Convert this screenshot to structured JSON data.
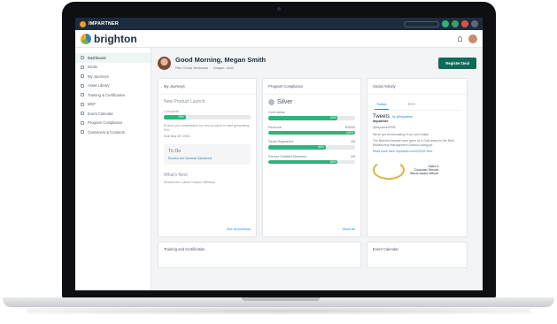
{
  "topbar": {
    "brand": "IMPARTNER"
  },
  "header": {
    "logo_text": "brighton"
  },
  "sidebar": {
    "items": [
      {
        "label": "Dashboard"
      },
      {
        "label": "Deals"
      },
      {
        "label": "My Journeys"
      },
      {
        "label": "Asset Library"
      },
      {
        "label": "Training & Certification"
      },
      {
        "label": "MDF"
      },
      {
        "label": "Event Calendar"
      },
      {
        "label": "Program Compliance"
      },
      {
        "label": "Customers & Contacts"
      }
    ]
  },
  "greeting": {
    "title": "Good Morning, Megan Smith",
    "company": "Red Cedar Networks",
    "location": "Draper, Utah",
    "register_button": "Register Deal"
  },
  "journeys": {
    "heading": "My Journeys",
    "journey_title": "New Product Launch",
    "status_label": "Complete",
    "progress_label": "25%",
    "progress": 0.25,
    "description": "Ensure you understand our new product to start generating ROI",
    "due": "Due Nov 29, 2021",
    "todo_title": "To Do",
    "todo_item": "Review the Newest Datasheet",
    "next_title": "What's Next",
    "next_item": "Review the Latest Product Webinar",
    "link": "See all journeys"
  },
  "compliance": {
    "heading": "Program Compliance",
    "tier": "Silver",
    "rows": [
      {
        "label": "Gold status",
        "right": "",
        "bar_label": "80%",
        "value": 0.8
      },
      {
        "label": "Revenue",
        "right": "$/5000",
        "bar_label": "100%",
        "value": 1.0
      },
      {
        "label": "Deals Registered",
        "right": "4/6",
        "bar_label": "66%",
        "value": 0.66
      },
      {
        "label": "Partner Certified Members",
        "right": "4/5",
        "bar_label": "80%",
        "value": 0.8
      }
    ],
    "link": "Show All"
  },
  "social": {
    "heading": "Social Activity",
    "tab_twitter": "Twitter",
    "tab_rss": "RSS",
    "tweets_title": "Tweets",
    "tweets_handle": "by @Impartner",
    "author": "Impartner",
    "author_handle": "@ImpartnerPRM",
    "tweet_line1": "We've got an innovating in our next today!",
    "tweet_line2": "The Brandon Awards have given us a Gold award in the Best Relationship Management Solution category!",
    "tweet_line3": "Read more here: impartner.com/2021/07/brn...",
    "award_line1": "Sales &",
    "award_line2": "Customer Service",
    "award_line3": "Stevie Award Winner"
  },
  "lower": {
    "training": "Training and Certification",
    "events": "Event Calendar"
  }
}
